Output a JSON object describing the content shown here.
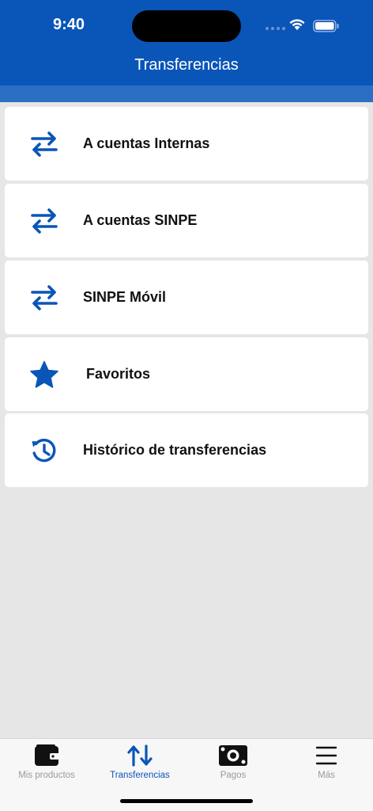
{
  "status_bar": {
    "time": "9:40"
  },
  "header": {
    "title": "Transferencias"
  },
  "menu": {
    "items": [
      {
        "label": "A cuentas Internas",
        "icon": "transfer-arrows-icon"
      },
      {
        "label": "A cuentas SINPE",
        "icon": "transfer-arrows-icon"
      },
      {
        "label": "SINPE Móvil",
        "icon": "transfer-arrows-icon"
      },
      {
        "label": "Favoritos",
        "icon": "star-icon"
      },
      {
        "label": "Histórico de transferencias",
        "icon": "history-icon"
      }
    ]
  },
  "tabbar": {
    "tabs": [
      {
        "label": "Mis productos",
        "icon": "wallet-icon",
        "active": false
      },
      {
        "label": "Transferencias",
        "icon": "transfer-arrows-icon",
        "active": true
      },
      {
        "label": "Pagos",
        "icon": "money-icon",
        "active": false
      },
      {
        "label": "Más",
        "icon": "menu-icon",
        "active": false
      }
    ]
  },
  "colors": {
    "primary": "#0a55b8",
    "header_band": "#2a6fc4",
    "background": "#e6e6e6",
    "inactive_tab": "#9a9a9a"
  }
}
